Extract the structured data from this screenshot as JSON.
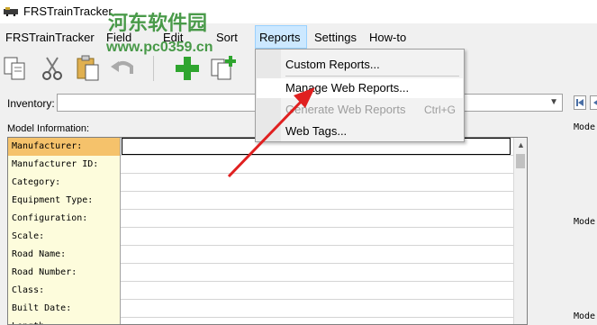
{
  "window": {
    "title": "FRSTrainTracker"
  },
  "watermark": {
    "text": "河东软件园",
    "url": "www.pc0359.cn"
  },
  "menubar": {
    "items": [
      {
        "id": "frstraintracker",
        "label": "FRSTrainTracker"
      },
      {
        "id": "field",
        "label": "Field"
      },
      {
        "id": "edit",
        "label": "Edit"
      },
      {
        "id": "sort",
        "label": "Sort"
      },
      {
        "id": "reports",
        "label": "Reports"
      },
      {
        "id": "settings",
        "label": "Settings"
      },
      {
        "id": "howto",
        "label": "How-to"
      }
    ]
  },
  "toolbar": {
    "buttons": [
      "copy-icon",
      "cut-icon",
      "paste-icon",
      "undo-icon",
      "add-icon",
      "add-copy-icon"
    ]
  },
  "inventory": {
    "label": "Inventory:",
    "value": ""
  },
  "model_info": {
    "label": "Model Information:",
    "fields": [
      "Manufacturer:",
      "Manufacturer ID:",
      "Category:",
      "Equipment Type:",
      "Configuration:",
      "Scale:",
      "Road Name:",
      "Road Number:",
      "Class:",
      "Built Date:",
      "Length:"
    ]
  },
  "right_panel": {
    "labels": [
      "Mode",
      "Mode",
      "Mode"
    ]
  },
  "reports_menu": {
    "items": [
      {
        "label": "Custom Reports...",
        "shortcut": "",
        "disabled": false
      },
      {
        "label": "Manage Web Reports...",
        "shortcut": "",
        "disabled": false
      },
      {
        "label": "Generate Web Reports",
        "shortcut": "Ctrl+G",
        "disabled": true
      },
      {
        "label": "Web Tags...",
        "shortcut": "",
        "disabled": false
      }
    ]
  },
  "colors": {
    "accent_arrow": "#e02020",
    "selected_label": "#f5c26b",
    "label_bg": "#fdfcdc",
    "menu_active": "#cce8ff"
  }
}
